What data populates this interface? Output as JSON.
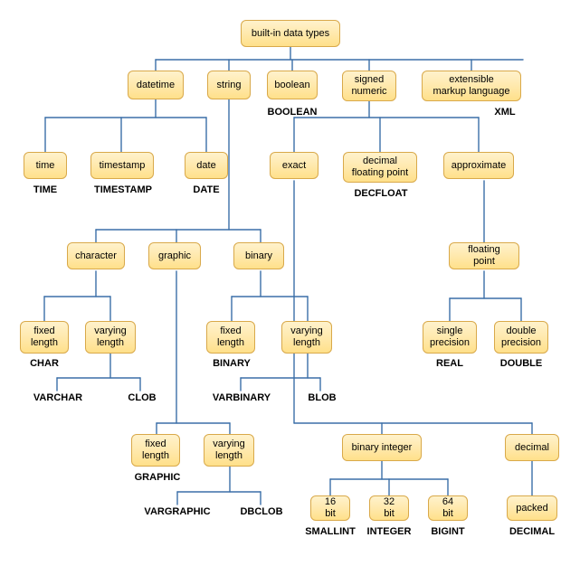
{
  "diagram": {
    "title": "built-in data types",
    "nodes": {
      "root": "built-in data types",
      "datetime": "datetime",
      "string": "string",
      "boolean": "boolean",
      "signed_numeric": "signed\nnumeric",
      "xml": "extensible\nmarkup language",
      "time": "time",
      "timestamp": "timestamp",
      "date": "date",
      "exact": "exact",
      "decfloat": "decimal\nfloating point",
      "approximate": "approximate",
      "character": "character",
      "graphic": "graphic",
      "binary": "binary",
      "floating_point": "floating point",
      "char_fixed": "fixed\nlength",
      "char_varying": "varying\nlength",
      "bin_fixed": "fixed\nlength",
      "bin_varying": "varying\nlength",
      "single_prec": "single\nprecision",
      "double_prec": "double\nprecision",
      "graph_fixed": "fixed\nlength",
      "graph_varying": "varying\nlength",
      "binary_integer": "binary integer",
      "decimal": "decimal",
      "bit16": "16 bit",
      "bit32": "32 bit",
      "bit64": "64 bit",
      "packed": "packed"
    },
    "labels": {
      "boolean": "BOOLEAN",
      "xml": "XML",
      "time": "TIME",
      "timestamp": "TIMESTAMP",
      "date": "DATE",
      "decfloat": "DECFLOAT",
      "char": "CHAR",
      "binary": "BINARY",
      "real": "REAL",
      "double": "DOUBLE",
      "varchar": "VARCHAR",
      "clob": "CLOB",
      "varbinary": "VARBINARY",
      "blob": "BLOB",
      "graphic": "GRAPHIC",
      "vargraphic": "VARGRAPHIC",
      "dbclob": "DBCLOB",
      "smallint": "SMALLINT",
      "integer": "INTEGER",
      "bigint": "BIGINT",
      "decimal": "DECIMAL"
    }
  }
}
